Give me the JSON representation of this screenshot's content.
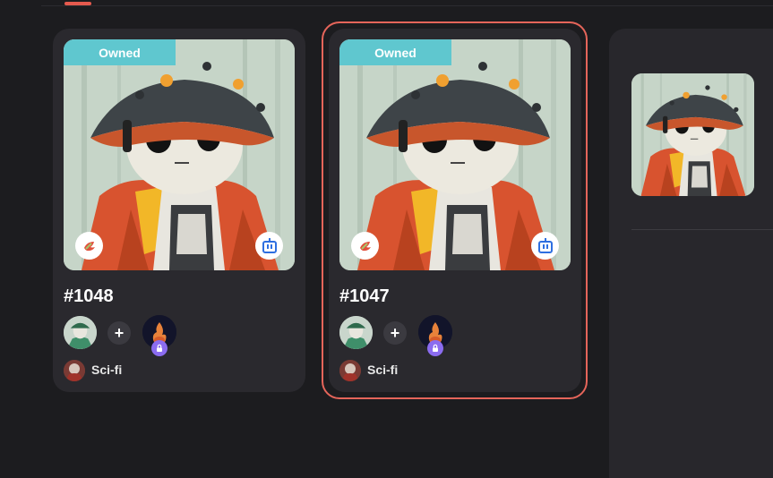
{
  "tabs": {
    "active_indicator_color": "#e55a4e"
  },
  "cards": [
    {
      "badge": "Owned",
      "title": "#1048",
      "left_icon": "bird-icon",
      "right_icon": "robot-icon",
      "plus": "+",
      "collection": "Sci-fi",
      "selected": false
    },
    {
      "badge": "Owned",
      "title": "#1047",
      "left_icon": "bird-icon",
      "right_icon": "robot-icon",
      "plus": "+",
      "collection": "Sci-fi",
      "selected": true
    }
  ],
  "colors": {
    "badge_bg": "#5fc7cf",
    "selection": "#e5655a",
    "lock_badge": "#8b6cf0",
    "card_bg": "#2a292e",
    "page_bg": "#1c1c1f"
  }
}
